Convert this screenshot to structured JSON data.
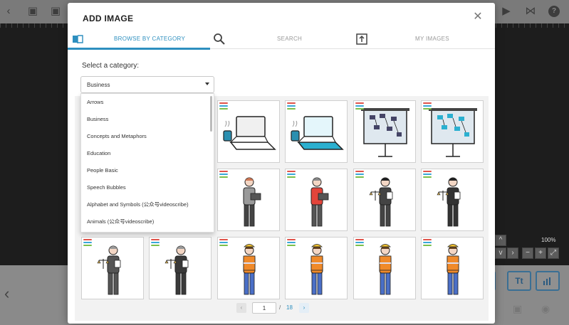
{
  "modal": {
    "title": "ADD IMAGE",
    "close_icon": "close-icon"
  },
  "tabs": [
    {
      "label": "BROWSE BY CATEGORY",
      "icon": "book-icon",
      "active": true
    },
    {
      "label": "SEARCH",
      "icon": "search-icon",
      "active": false
    },
    {
      "label": "MY IMAGES",
      "icon": "upload-icon",
      "active": false
    }
  ],
  "category": {
    "label": "Select a category:",
    "selected": "Business",
    "options": [
      "Arrows",
      "Business",
      "Concepts and Metaphors",
      "Education",
      "People Basic",
      "Speech Bubbles",
      "Alphabet and Symbols (公众号videoscribe)",
      "Animals (公众号videoscribe)"
    ]
  },
  "images": [
    {
      "subject": "laptop-coffee"
    },
    {
      "subject": "laptop-coffee-color"
    },
    {
      "subject": "presentation-board"
    },
    {
      "subject": "presentation-board-color"
    },
    {
      "subject": "woman-laptop"
    },
    {
      "subject": "man-laptop-red"
    },
    {
      "subject": "woman-justice-scales"
    },
    {
      "subject": "man-justice-scales"
    },
    {
      "subject": "woman-justice-scales-gray"
    },
    {
      "subject": "man-justice-scales-gray"
    },
    {
      "subject": "construction-worker-woman"
    },
    {
      "subject": "construction-worker-man"
    },
    {
      "subject": "construction-worker-woman-2"
    },
    {
      "subject": "construction-worker-man-2"
    }
  ],
  "pagination": {
    "current": "1",
    "separator": "/",
    "total": "18",
    "prev_icon": "chevron-left-icon",
    "next_icon": "chevron-right-icon"
  },
  "background": {
    "zoom": "100%",
    "text_tool": "Tt"
  },
  "colors": {
    "accent": "#2d8fbf",
    "badge": [
      "#e0524a",
      "#3aa7d8",
      "#7bbf4a"
    ]
  }
}
